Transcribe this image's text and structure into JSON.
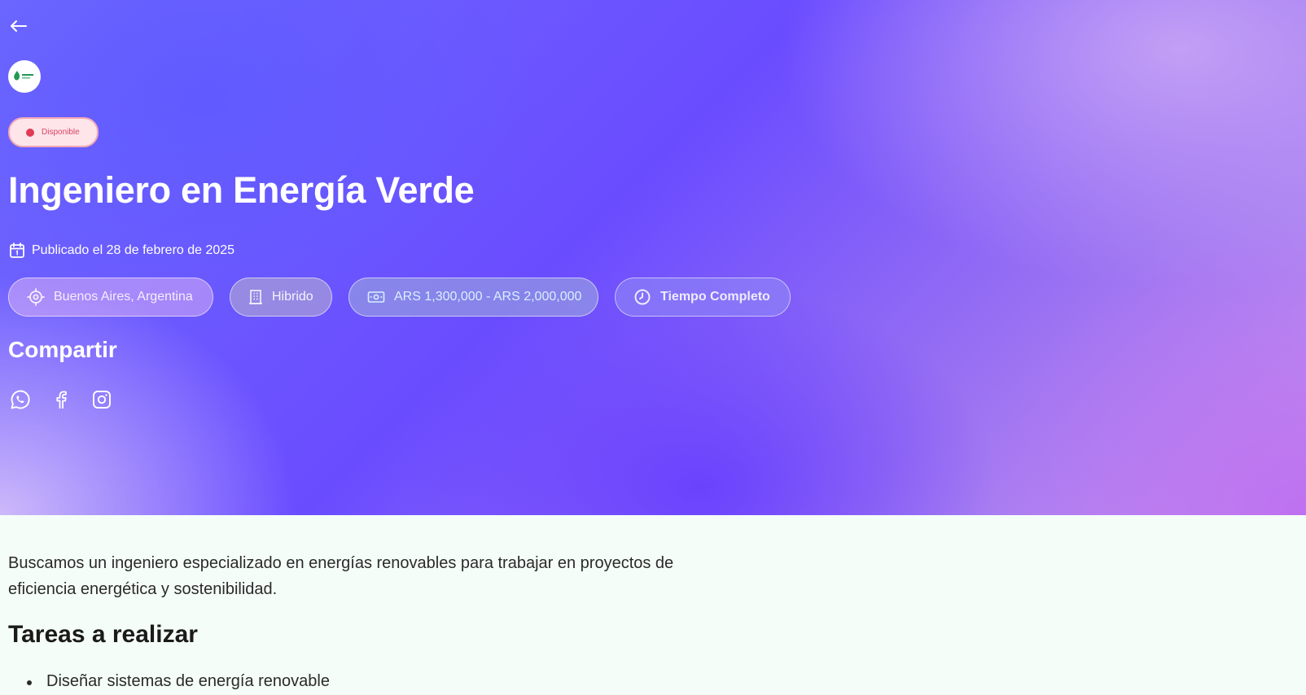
{
  "nav": {
    "back_icon": "arrow-left-icon"
  },
  "company": {
    "logo_icon": "leaf-logo-icon"
  },
  "status": {
    "label": "Disponible",
    "color": "#e23b55"
  },
  "job": {
    "title": "Ingeniero en Energía Verde",
    "published": "Publicado el 28 de febrero de 2025",
    "location": "Buenos Aires, Argentina",
    "modality": "Hibrido",
    "salary": "ARS 1,300,000 - ARS 2,000,000",
    "schedule": "Tiempo Completo"
  },
  "share": {
    "title": "Compartir",
    "networks": [
      "whatsapp-icon",
      "facebook-icon",
      "instagram-icon"
    ]
  },
  "details": {
    "description": "Buscamos un ingeniero especializado en energías renovables para trabajar en proyectos de eficiencia energética y sostenibilidad.",
    "tasks_title": "Tareas a realizar",
    "tasks": [
      "Diseñar sistemas de energía renovable"
    ]
  },
  "colors": {
    "accent": "#6a4cff",
    "page_bg": "#f5fdf8"
  }
}
